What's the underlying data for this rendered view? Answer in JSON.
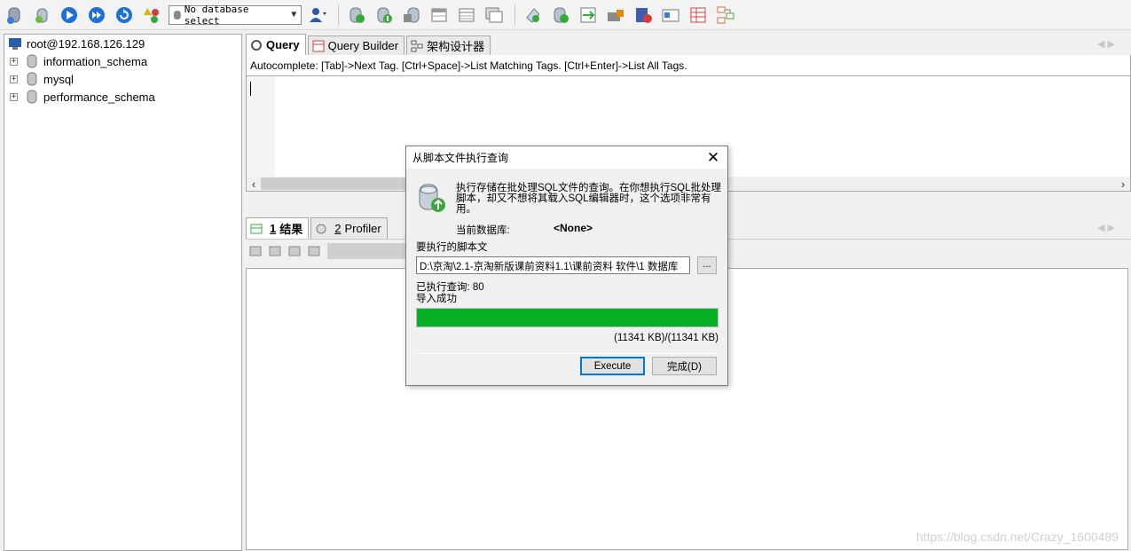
{
  "toolbar": {
    "icons": [
      "connect-icon",
      "new-connection-icon",
      "execute-icon",
      "execute-all-icon",
      "refresh-icon",
      "objects-icon",
      "user-manager-icon",
      "create-db-icon",
      "backup-db-icon",
      "restore-db-icon",
      "table-data-icon",
      "table-structure-icon",
      "table-copy-icon",
      "sync-icon",
      "schema-sync-icon",
      "import-icon",
      "export-icon",
      "job-icon",
      "transfer-icon",
      "form-icon",
      "table-grid-icon",
      "schema-designer-icon"
    ],
    "db_select": "No database select"
  },
  "object_browser": {
    "root": "root@192.168.126.129",
    "databases": [
      "information_schema",
      "mysql",
      "performance_schema"
    ]
  },
  "editor": {
    "tabs": [
      "Query",
      "Query Builder",
      "架构设计器"
    ],
    "autocomplete_hint": "Autocomplete: [Tab]->Next Tag. [Ctrl+Space]->List Matching Tags. [Ctrl+Enter]->List All Tags."
  },
  "results": {
    "tabs": [
      {
        "num": "1",
        "label": "结果"
      },
      {
        "num": "2",
        "label": "Profiler"
      }
    ],
    "watermark": "https://blog.csdn.net/Crazy_1600489"
  },
  "dialog": {
    "title": "从脚本文件执行查询",
    "description": "执行存储在批处理SQL文件的查询。在你想执行SQL批处理脚本，却又不想将其载入SQL编辑器时，这个选项非常有用。",
    "current_db_label": "当前数据库:",
    "current_db_value": "<None>",
    "script_label": "要执行的脚本文",
    "script_path": "D:\\京淘\\2.1-京淘新版课前资料1.1\\课前资料 软件\\1 数据库",
    "browse_label": "...",
    "executed_queries": "已执行查询: 80",
    "status": "导入成功",
    "progress": 1.0,
    "size_text": "(11341 KB)/(11341 KB)",
    "execute_label": "Execute",
    "done_label": "完成(D)",
    "close_glyph": "✕"
  }
}
